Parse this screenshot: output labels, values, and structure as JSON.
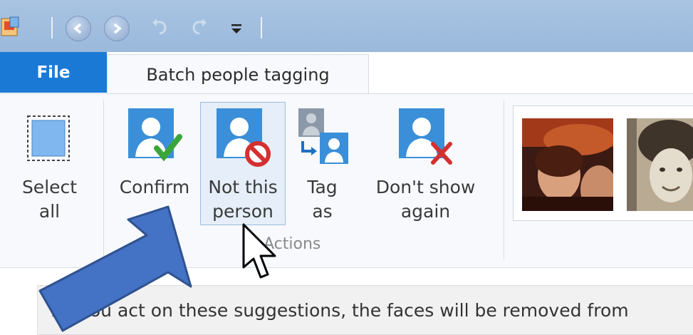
{
  "tabs": {
    "file": "File",
    "active": "Batch people tagging"
  },
  "ribbon": {
    "select_all": "Select\nall",
    "confirm": "Confirm",
    "not_this_person": "Not this\nperson",
    "tag_as": "Tag\nas",
    "dont_show_again": "Don't show\nagain",
    "group_label": "Actions"
  },
  "info_bar": {
    "text": "As you act on these suggestions, the faces will be removed from"
  },
  "colors": {
    "accent": "#1b79d6",
    "arrow": "#4472c4",
    "ribbon_bg": "#f7f9fc",
    "titlebar": "#a9c4e2"
  },
  "icons": [
    "app-icon",
    "back-icon",
    "forward-icon",
    "undo-icon",
    "redo-icon",
    "customize-caret-icon",
    "select-all-icon",
    "confirm-icon",
    "not-this-person-icon",
    "tag-as-icon",
    "dont-show-again-icon",
    "annotation-arrow",
    "mouse-cursor-icon"
  ]
}
